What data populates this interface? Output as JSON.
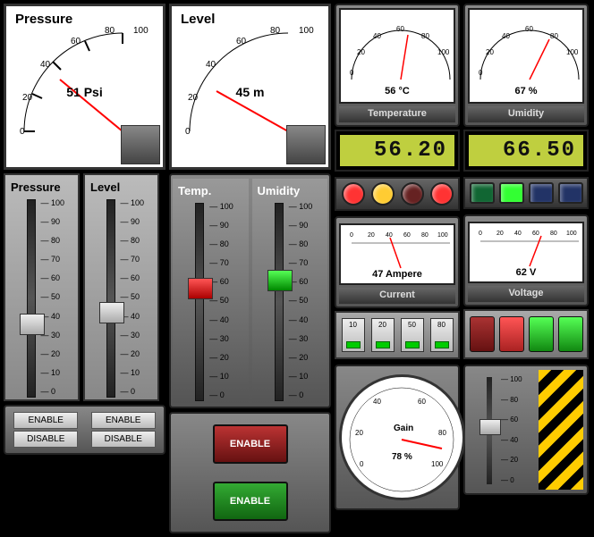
{
  "pressure_gauge": {
    "title": "Pressure",
    "value": "51 Psi",
    "ticks": [
      "0",
      "20",
      "40",
      "60",
      "80",
      "100"
    ]
  },
  "level_gauge": {
    "title": "Level",
    "value": "45 m",
    "ticks": [
      "0",
      "20",
      "40",
      "60",
      "80",
      "100"
    ]
  },
  "pressure_slider": {
    "title": "Pressure",
    "btn_en": "ENABLE",
    "btn_dis": "DISABLE",
    "value": 42
  },
  "level_slider": {
    "title": "Level",
    "btn_en": "ENABLE",
    "btn_dis": "DISABLE",
    "value": 48
  },
  "temp_slider": {
    "title": "Temp.",
    "btn": "ENABLE",
    "value": 62
  },
  "umidity_slider": {
    "title": "Umidity",
    "btn": "ENABLE",
    "value": 66
  },
  "slider_ticks": [
    "100",
    "90",
    "80",
    "70",
    "60",
    "50",
    "40",
    "30",
    "20",
    "10",
    "0"
  ],
  "temperature": {
    "label": "Temperature",
    "gauge_val": "56 °C",
    "lcd": "56.20",
    "ticks": [
      "0",
      "20",
      "40",
      "60",
      "80",
      "100"
    ]
  },
  "humidity": {
    "label": "Umidity",
    "gauge_val": "67 %",
    "lcd": "66.50",
    "ticks": [
      "0",
      "20",
      "40",
      "60",
      "80",
      "100"
    ]
  },
  "current": {
    "label": "Current",
    "value": "47 Ampere",
    "ticks": [
      "0",
      "20",
      "40",
      "60",
      "80",
      "100"
    ]
  },
  "voltage": {
    "label": "Voltage",
    "value": "62 V",
    "ticks": [
      "0",
      "20",
      "40",
      "60",
      "80",
      "100"
    ]
  },
  "current_toggles": [
    "10",
    "20",
    "50",
    "80"
  ],
  "gain": {
    "label": "Gain",
    "value": "78 %",
    "ticks": [
      "0",
      "20",
      "40",
      "60",
      "80",
      "100"
    ]
  },
  "gain_slider_ticks": [
    "100",
    "80",
    "60",
    "40",
    "20",
    "0"
  ],
  "led_colors": {
    "l1": "#f33",
    "l2": "#fc3",
    "l3": "#622",
    "l4": "#f33"
  },
  "sq_led_colors": {
    "l1": "#163",
    "l2": "#3f3",
    "l3": "#236",
    "l4": "#236"
  },
  "rocker_colors": {
    "r1": "#a33",
    "r2": "#f44",
    "r3": "#3f3",
    "r4": "#3f3"
  },
  "chart_data": [
    {
      "type": "gauge",
      "title": "Pressure",
      "value": 51,
      "unit": "Psi",
      "range": [
        0,
        100
      ]
    },
    {
      "type": "gauge",
      "title": "Level",
      "value": 45,
      "unit": "m",
      "range": [
        0,
        100
      ]
    },
    {
      "type": "gauge",
      "title": "Temperature",
      "value": 56,
      "unit": "°C",
      "range": [
        0,
        100
      ],
      "lcd": 56.2
    },
    {
      "type": "gauge",
      "title": "Umidity",
      "value": 67,
      "unit": "%",
      "range": [
        0,
        100
      ],
      "lcd": 66.5
    },
    {
      "type": "meter",
      "title": "Current",
      "value": 47,
      "unit": "Ampere",
      "range": [
        0,
        100
      ]
    },
    {
      "type": "meter",
      "title": "Voltage",
      "value": 62,
      "unit": "V",
      "range": [
        0,
        100
      ]
    },
    {
      "type": "gauge",
      "title": "Gain",
      "value": 78,
      "unit": "%",
      "range": [
        0,
        100
      ]
    }
  ]
}
